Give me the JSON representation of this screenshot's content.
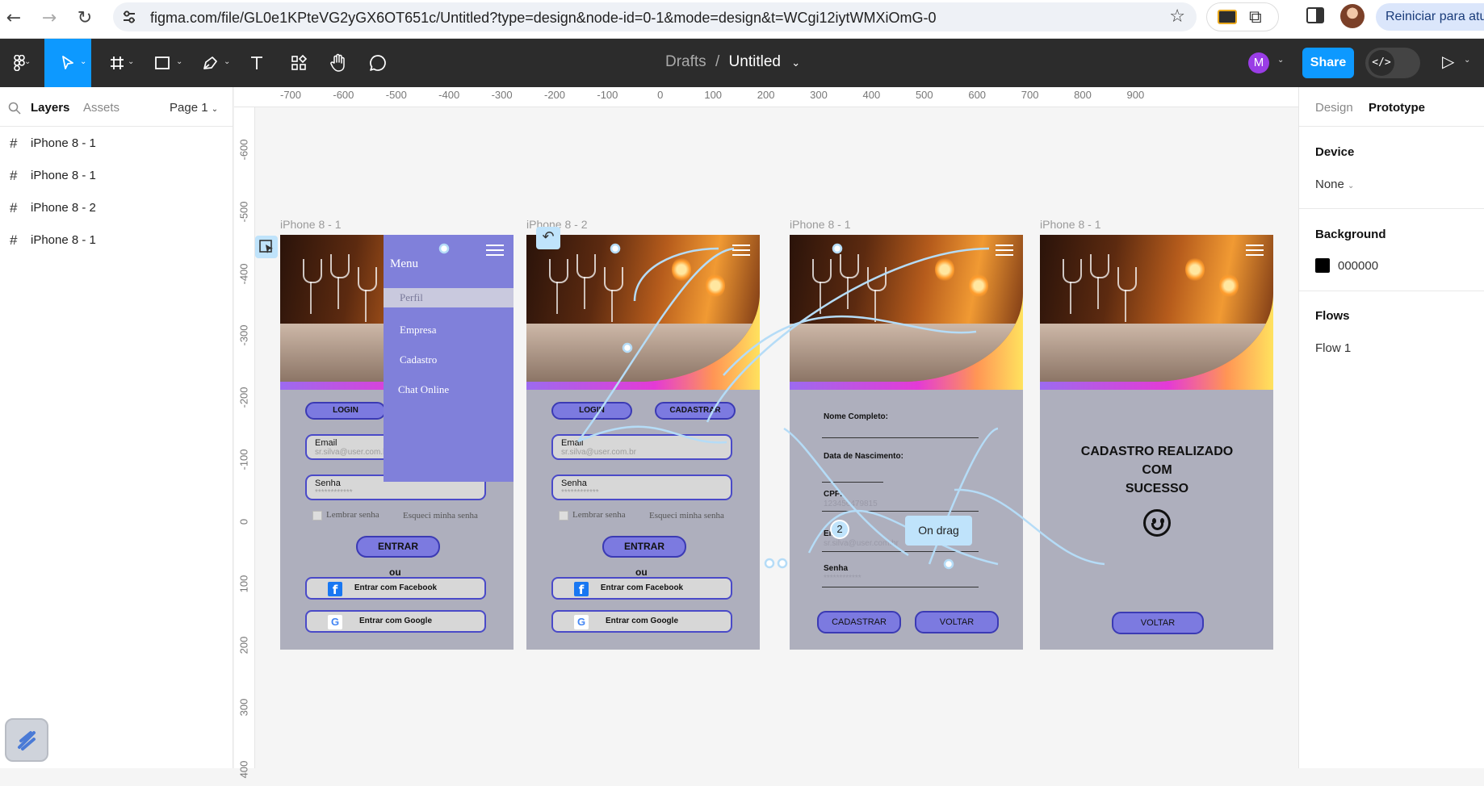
{
  "browser": {
    "url": "figma.com/file/GL0e1KPteVG2yGX6OT651c/Untitled?type=design&node-id=0-1&mode=design&t=WCgi12iytWMXiOmG-0",
    "restart_label": "Reiniciar para atualizar"
  },
  "toolbar": {
    "breadcrumb_root": "Drafts",
    "breadcrumb_sep": "/",
    "file_name": "Untitled",
    "user_initial": "M",
    "share_label": "Share"
  },
  "left_panel": {
    "tab_layers": "Layers",
    "tab_assets": "Assets",
    "page_label": "Page 1",
    "layers": [
      {
        "label": "iPhone 8 - 1"
      },
      {
        "label": "iPhone 8 - 1"
      },
      {
        "label": "iPhone 8 - 2"
      },
      {
        "label": "iPhone 8 - 1"
      }
    ]
  },
  "right_panel": {
    "tab_design": "Design",
    "tab_prototype": "Prototype",
    "device_heading": "Device",
    "device_value": "None",
    "background_heading": "Background",
    "background_value": "000000",
    "flows_heading": "Flows",
    "flow_item": "Flow 1"
  },
  "rulers": {
    "h": [
      "-700",
      "-600",
      "-500",
      "-400",
      "-300",
      "-200",
      "-100",
      "0",
      "100",
      "200",
      "300",
      "400",
      "500",
      "600",
      "700",
      "800",
      "900"
    ],
    "v": [
      "-600",
      "-500",
      "-400",
      "-300",
      "-200",
      "-100",
      "0",
      "100",
      "200",
      "300",
      "400"
    ]
  },
  "frames": {
    "f1_label": "iPhone 8 - 1",
    "f2_label": "iPhone 8 - 2",
    "f3_label": "iPhone 8 - 1",
    "f4_label": "iPhone 8 - 1"
  },
  "login": {
    "login_tab": "LOGIN",
    "register_tab": "CADASTRAR",
    "email_label": "Email",
    "email_value": "sr.silva@user.com.br",
    "password_label": "Senha",
    "password_value": "************",
    "remember": "Lembrar senha",
    "forgot": "Esqueci minha senha",
    "enter": "ENTRAR",
    "or": "ou",
    "facebook": "Entrar com Facebook",
    "google": "Entrar com Google"
  },
  "menu": {
    "title": "Menu",
    "items": [
      "Perfil",
      "Empresa",
      "Cadastro",
      "Chat Online"
    ]
  },
  "register": {
    "full_name": "Nome Completo:",
    "birth_date": "Data de Nascimento:",
    "cpf": "CPF:",
    "cpf_value": "123456479815",
    "email": "Email",
    "email_value": "sr.silva@user.com.br",
    "password": "Senha",
    "password_value": "************",
    "register_btn": "CADASTRAR",
    "back_btn": "VOLTAR"
  },
  "confirm": {
    "line1": "CADASTRO REALIZADO",
    "line2": "COM",
    "line3": "SUCESSO",
    "back_btn": "VOLTAR"
  },
  "prototype": {
    "trigger_label": "On drag",
    "connection_count": "2"
  },
  "colors": {
    "accent": "#0d99ff",
    "frame_bg": "#aeafbd",
    "button": "#7c7ae0",
    "menu": "#8080da",
    "connector": "#b5dcf7"
  }
}
